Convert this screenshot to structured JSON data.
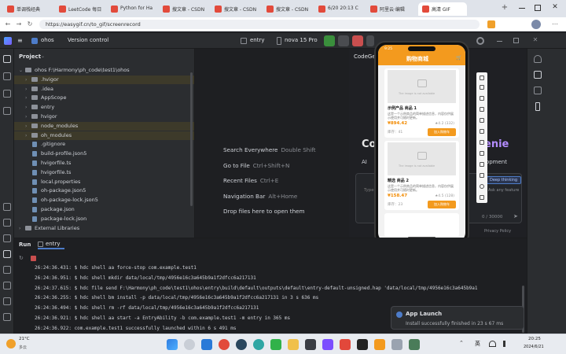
{
  "browser": {
    "tabs": [
      {
        "label": "单调栈经典"
      },
      {
        "label": "LeetCode 每日"
      },
      {
        "label": "Python for Ha"
      },
      {
        "label": "搜文章 - CSDN"
      },
      {
        "label": "搜文章 - CSDN"
      },
      {
        "label": "搜文章 - CSDN"
      },
      {
        "label": "6/20 20:13 C"
      },
      {
        "label": "阿里云·编辑"
      },
      {
        "label": "高清 GIF"
      }
    ],
    "url": "https://easygif.cn/to_gif/screenrecord"
  },
  "ide": {
    "project_name": "ohos",
    "vcs": "Version control",
    "module": "entry",
    "device": "nova 15 Pro",
    "panel_title": "Project",
    "tree": [
      {
        "label": "ohos  F:\\Harmony\\ph_code\\test1\\ohos",
        "indent": 1,
        "kind": "folder",
        "open": true
      },
      {
        "label": ".hvigor",
        "indent": 2,
        "kind": "folder",
        "highlight": true
      },
      {
        "label": ".idea",
        "indent": 2,
        "kind": "folder"
      },
      {
        "label": "AppScope",
        "indent": 2,
        "kind": "folder"
      },
      {
        "label": "entry",
        "indent": 2,
        "kind": "folder"
      },
      {
        "label": "hvigor",
        "indent": 2,
        "kind": "folder"
      },
      {
        "label": "node_modules",
        "indent": 2,
        "kind": "folder",
        "highlight": true
      },
      {
        "label": "oh_modules",
        "indent": 2,
        "kind": "folder",
        "highlight": true
      },
      {
        "label": ".gitignore",
        "indent": 2,
        "kind": "file"
      },
      {
        "label": "build-profile.json5",
        "indent": 2,
        "kind": "file"
      },
      {
        "label": "hvigorfile.ts",
        "indent": 2,
        "kind": "file"
      },
      {
        "label": "hvigorfile.ts",
        "indent": 2,
        "kind": "file"
      },
      {
        "label": "local.properties",
        "indent": 2,
        "kind": "file"
      },
      {
        "label": "oh-package.json5",
        "indent": 2,
        "kind": "file"
      },
      {
        "label": "oh-package-lock.json5",
        "indent": 2,
        "kind": "file"
      },
      {
        "label": "package.json",
        "indent": 2,
        "kind": "file"
      },
      {
        "label": "package-lock.json",
        "indent": 2,
        "kind": "file"
      },
      {
        "label": "External Libraries",
        "indent": 1,
        "kind": "folder"
      }
    ],
    "welcome": [
      {
        "label": "Search Everywhere",
        "key": "Double Shift"
      },
      {
        "label": "Go to File",
        "key": "Ctrl+Shift+N"
      },
      {
        "label": "Recent Files",
        "key": "Ctrl+E"
      },
      {
        "label": "Navigation Bar",
        "key": "Alt+Home"
      },
      {
        "label": "Drop files here to open them",
        "key": ""
      }
    ],
    "genie": {
      "title": "CodeGenie",
      "hero": "Co",
      "hero_tail": "enie",
      "sub": "AI",
      "sub_tail": "lopment",
      "chip": "Deep thinking",
      "input_hint": "Type your question...",
      "note": "Ask any feature",
      "counter": "0 / 30000",
      "privacy": "Privacy Policy"
    },
    "run": {
      "tab_run": "Run",
      "config": "entry",
      "logs": [
        "26:24:36.431: $ hdc shell aa force-stop com.example.test1",
        "26:24:36.951: $ hdc shell mkdir data/local/tmp/4956e16c3a645b9a1f2dfcc6a217131",
        "26:24:37.615: $ hdc file send F:\\Harmony\\ph_code\\test1\\ohos\\entry\\build\\default\\outputs\\default\\entry-default-unsigned.hap 'data/local/tmp/4956e16c3a645b9a1",
        "26:24:36.255: $ hdc shell bm install -p data/local/tmp/4956e16c3a645b9a1f2dfcc6a217131 in 3 s 636 ms",
        "26:24:36.494: $ hdc shell rm -rf data/local/tmp/4956e16c3a645b9a1f2dfcc6a217131",
        "26:24:36.921: $ hdc shell aa start -a EntryAbility -b com.example.test1 -m entry in 365 ms",
        "26:24:36.922: com.example.test1 successfully launched within 6 s 491 ms"
      ]
    },
    "toast": {
      "title": "App Launch",
      "body": "Install successfully finished in 23 s 67 ms"
    }
  },
  "phone": {
    "status_time": "9:25",
    "app_title": "购物商城",
    "image_placeholder": "The image is not available",
    "products": [
      {
        "title": "示例产品 商品 1",
        "desc": "这是一个示例商品的简单描述信息，内容仅供展示使用并可随时更新。",
        "price": "¥894.42",
        "rating": "★4.2 (332)",
        "stock": "库存：41",
        "buy": "加入购物车"
      },
      {
        "title": "精选 商品 2",
        "desc": "这是一个示例商品的简单描述信息，内容仅供展示使用并可随时更新。",
        "price": "¥158.47",
        "rating": "★4.5 (128)",
        "stock": "库存：23",
        "buy": "加入购物车"
      }
    ]
  },
  "taskbar": {
    "weather": "21°C",
    "weather_sub": "多云",
    "lang": "英",
    "time": "20:25",
    "date": "2024/6/21"
  },
  "colors": {
    "accent_orange": "#f39a1e",
    "ide_bg": "#1e1f22",
    "panel_bg": "#2b2d30"
  }
}
